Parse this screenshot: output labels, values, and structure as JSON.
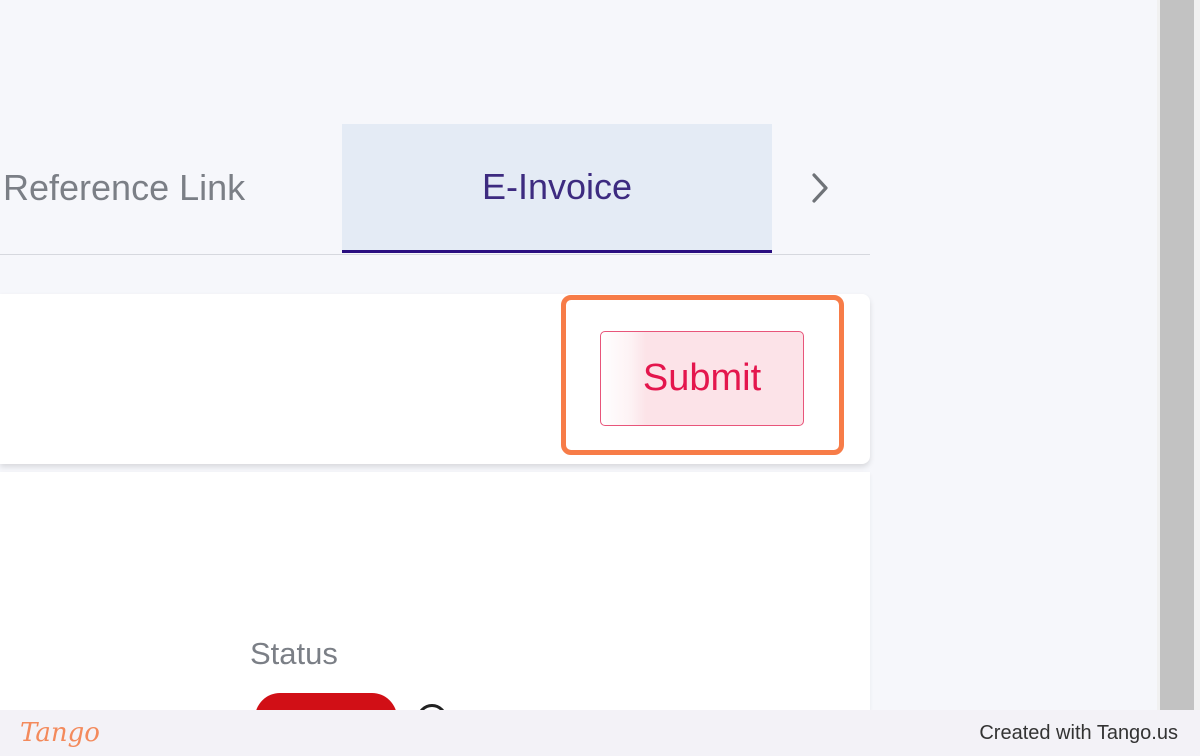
{
  "tabs": {
    "items": [
      {
        "label": "Reference Link",
        "active": false
      },
      {
        "label": "E-Invoice",
        "active": true
      }
    ],
    "next_icon": "chevron-right-icon"
  },
  "actions": {
    "submit_label": "Submit"
  },
  "details": {
    "status_label": "Status"
  },
  "footer": {
    "logo_text": "Tango",
    "credit": "Created with Tango.us"
  },
  "colors": {
    "highlight": "#f77c48",
    "submit_text": "#e4164d",
    "active_tab_bg": "#e4ebf5",
    "active_tab_indicator": "#2a0f80",
    "status_pill": "#d10f16"
  }
}
